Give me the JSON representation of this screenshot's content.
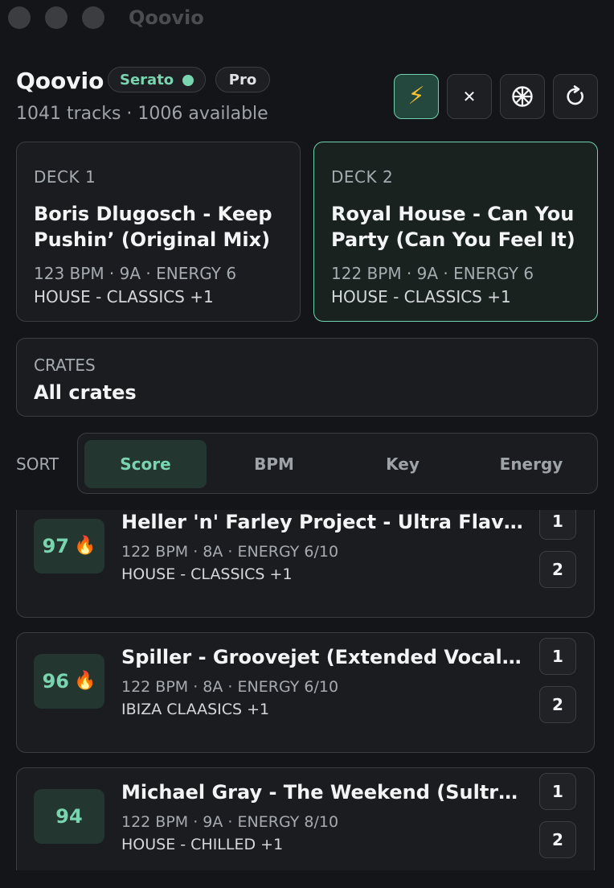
{
  "window": {
    "title": "Qoovio"
  },
  "header": {
    "app_name": "Qoovio",
    "badges": [
      {
        "label": "Serato",
        "status": "connected"
      },
      {
        "label": "Pro"
      }
    ],
    "subtitle": "1041 tracks · 1006 available",
    "toolbar": [
      {
        "icon": "lightning-icon",
        "glyph": "⚡",
        "active": true
      },
      {
        "icon": "close-icon",
        "glyph": "✕"
      },
      {
        "icon": "wheel-icon"
      },
      {
        "icon": "refresh-icon"
      }
    ]
  },
  "decks": [
    {
      "label": "DECK 1",
      "title": "Boris Dlugosch - Keep Pushin’ (Original Mix)",
      "meta": "123 BPM · 9A · ENERGY 6",
      "tags": "HOUSE - CLASSICS +1",
      "active": false
    },
    {
      "label": "DECK 2",
      "title": "Royal House - Can You Party (Can You Feel It)",
      "meta": "122 BPM · 9A · ENERGY 6",
      "tags": "HOUSE - CLASSICS +1",
      "active": true
    }
  ],
  "crates": {
    "label": "CRATES",
    "value": "All crates"
  },
  "sort": {
    "label": "SORT",
    "options": [
      "Score",
      "BPM",
      "Key",
      "Energy"
    ],
    "selected": "Score"
  },
  "tracks": [
    {
      "score": "97",
      "hot": true,
      "title": "Heller 'n' Farley Project - Ultra Flava ...",
      "meta": "122 BPM · 8A · ENERGY 6/10",
      "tags": "HOUSE - CLASSICS +1",
      "deck_buttons": [
        "1",
        "2"
      ]
    },
    {
      "score": "96",
      "hot": true,
      "title": "Spiller - Groovejet (Extended Vocal ...",
      "meta": "122 BPM · 8A · ENERGY 6/10",
      "tags": "IBIZA CLAASICS +1",
      "deck_buttons": [
        "1",
        "2"
      ]
    },
    {
      "score": "94",
      "hot": false,
      "title": "Michael Gray - The Weekend (Sultra ...",
      "meta": "122 BPM · 9A · ENERGY 8/10",
      "tags": "HOUSE - CHILLED +1",
      "deck_buttons": [
        "1",
        "2"
      ]
    }
  ],
  "colors": {
    "accent": "#79d4b0",
    "accent_border": "#6fd3ad",
    "background": "#141518",
    "fire": "#f07a2a"
  }
}
